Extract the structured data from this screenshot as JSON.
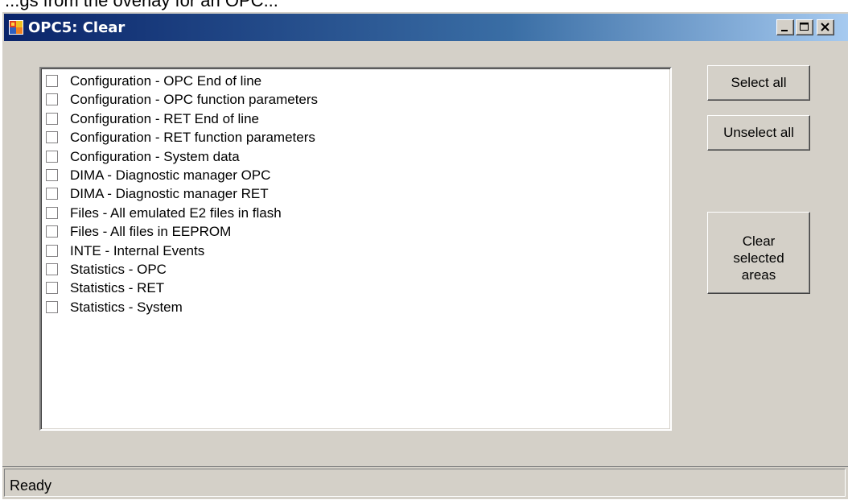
{
  "top_caption": "...gs from the overlay for an OPC...",
  "window": {
    "title": "OPC5: Clear",
    "controls": {
      "minimize_icon": "minimize-icon",
      "maximize_icon": "maximize-icon",
      "close_icon": "close-icon"
    }
  },
  "list": {
    "items": [
      {
        "label": "Configuration - OPC End of line",
        "checked": false
      },
      {
        "label": "Configuration -  OPC function parameters",
        "checked": false
      },
      {
        "label": "Configuration - RET End of line",
        "checked": false
      },
      {
        "label": "Configuration - RET function parameters",
        "checked": false
      },
      {
        "label": "Configuration - System data",
        "checked": false
      },
      {
        "label": "DIMA - Diagnostic manager OPC",
        "checked": false
      },
      {
        "label": "DIMA - Diagnostic manager RET",
        "checked": false
      },
      {
        "label": "Files - All emulated E2 files in flash",
        "checked": false
      },
      {
        "label": "Files - All files in EEPROM",
        "checked": false
      },
      {
        "label": "INTE - Internal Events",
        "checked": false
      },
      {
        "label": "Statistics - OPC",
        "checked": false
      },
      {
        "label": "Statistics - RET",
        "checked": false
      },
      {
        "label": "Statistics - System",
        "checked": false
      }
    ]
  },
  "buttons": {
    "select_all": "Select all",
    "unselect_all": "Unselect all",
    "clear_line1": "Clear",
    "clear_line2": "selected",
    "clear_line3": "areas"
  },
  "status": {
    "text": "Ready"
  },
  "colors": {
    "titlebar_start": "#0a246a",
    "titlebar_end": "#a6caf0",
    "face": "#d4d0c8"
  }
}
